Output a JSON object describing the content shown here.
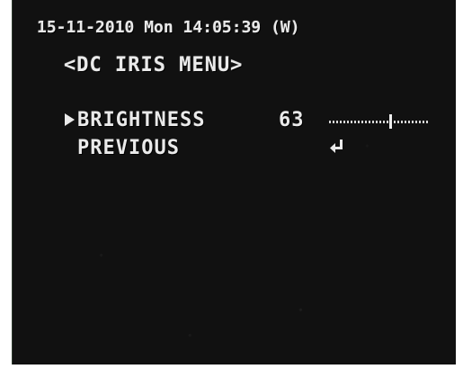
{
  "osd": {
    "timestamp": "15-11-2010 Mon 14:05:39 (W)",
    "menu_title": "<DC IRIS MENU>",
    "items": [
      {
        "label": "BRIGHTNESS",
        "value": "63",
        "level_percent": 63,
        "selected": true
      },
      {
        "label": "PREVIOUS",
        "icon": "enter-return-icon"
      }
    ]
  },
  "colors": {
    "background": "#111111",
    "text": "#eaeaea"
  }
}
